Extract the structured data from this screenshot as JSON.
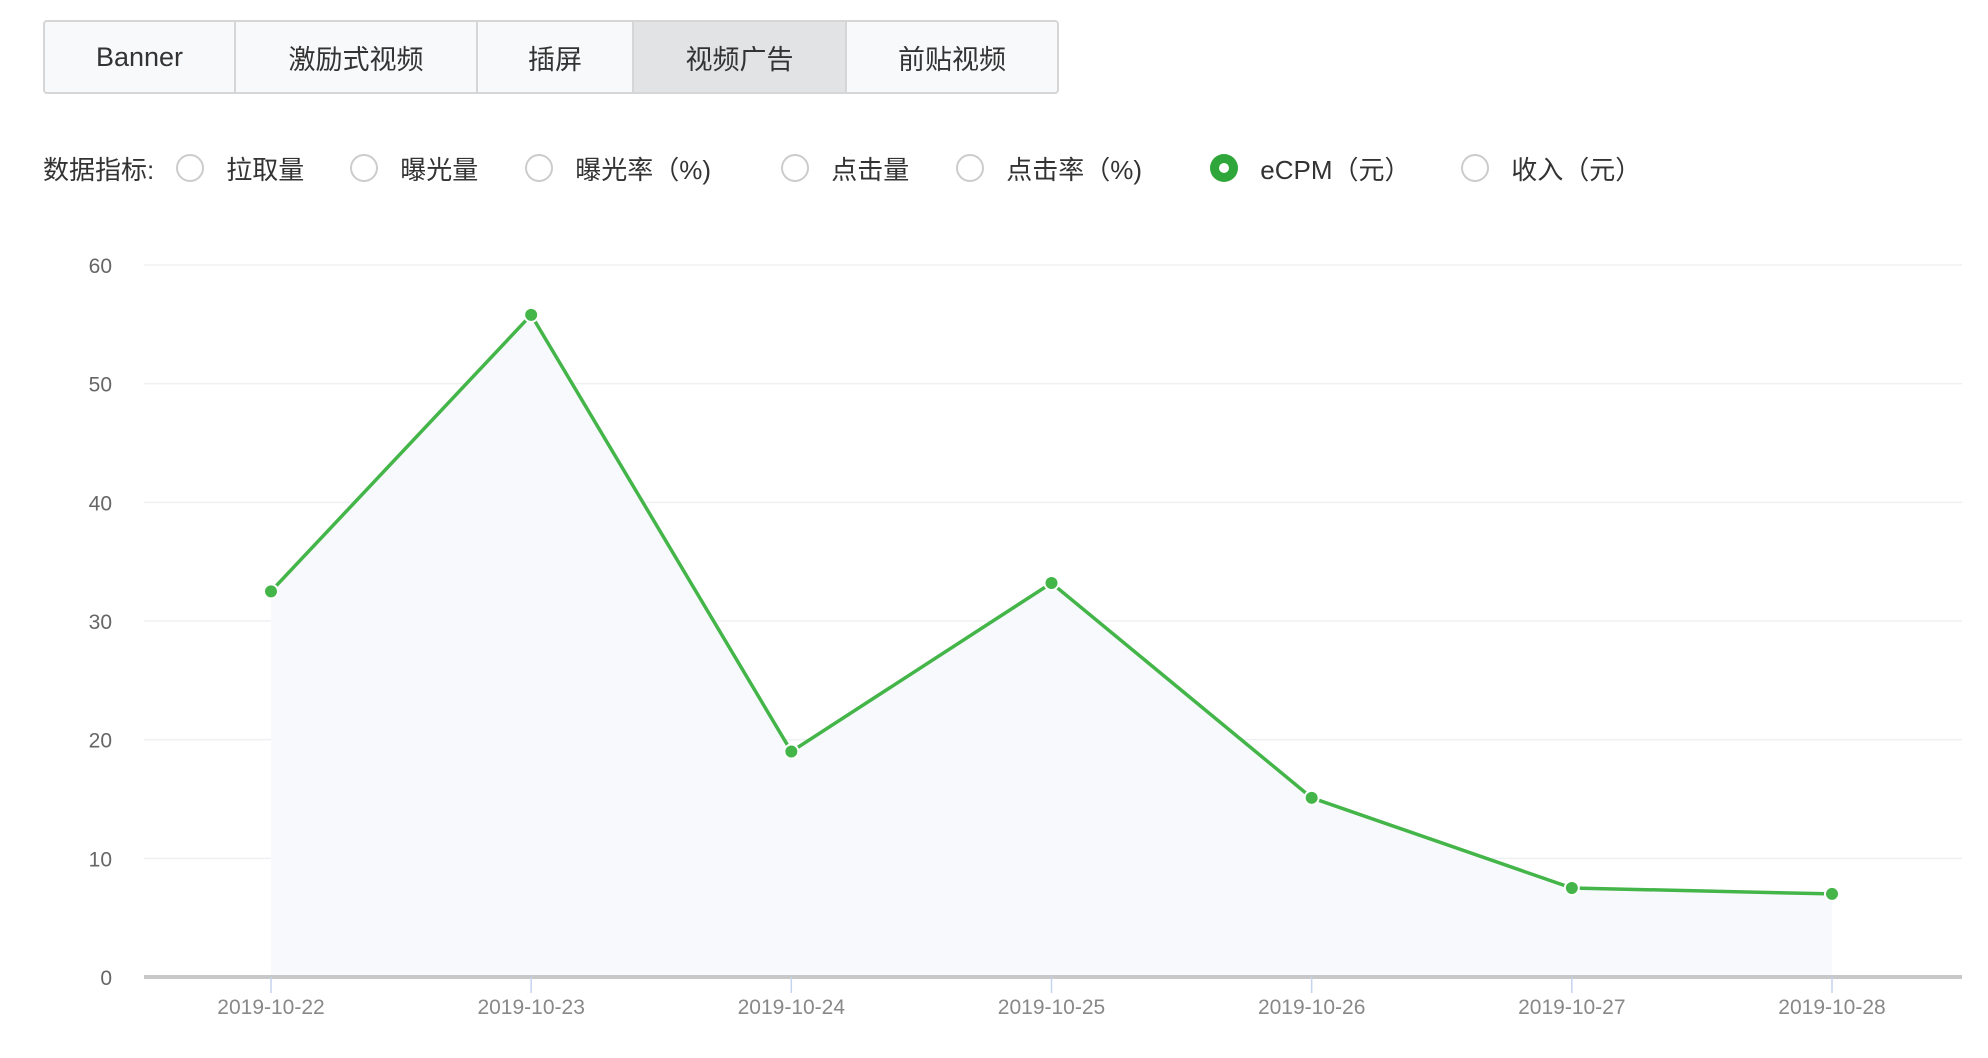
{
  "tabs": [
    {
      "label": "Banner",
      "active": false
    },
    {
      "label": "激励式视频",
      "active": false
    },
    {
      "label": "插屏",
      "active": false
    },
    {
      "label": "视频广告",
      "active": true
    },
    {
      "label": "前贴视频",
      "active": false
    }
  ],
  "metrics": {
    "label": "数据指标:",
    "options": [
      {
        "label": "拉取量",
        "selected": false
      },
      {
        "label": "曝光量",
        "selected": false
      },
      {
        "label": "曝光率（%)",
        "selected": false
      },
      {
        "label": "点击量",
        "selected": false
      },
      {
        "label": "点击率（%)",
        "selected": false
      },
      {
        "label": "eCPM（元）",
        "selected": true
      },
      {
        "label": "收入（元）",
        "selected": false
      }
    ]
  },
  "colors": {
    "line": "#44b549",
    "area": "#f7f9fc",
    "grid": "#eef0f3",
    "axis": "#c8c8c8"
  },
  "chart_data": {
    "type": "line",
    "title": "",
    "xlabel": "",
    "ylabel": "",
    "categories": [
      "2019-10-22",
      "2019-10-23",
      "2019-10-24",
      "2019-10-25",
      "2019-10-26",
      "2019-10-27",
      "2019-10-28"
    ],
    "series": [
      {
        "name": "eCPM（元）",
        "values": [
          32.5,
          55.8,
          19.0,
          33.2,
          15.1,
          7.5,
          7.0
        ]
      }
    ],
    "ylim": [
      0,
      60
    ],
    "yticks": [
      "0",
      "10",
      "20",
      "30",
      "40",
      "50",
      "60"
    ],
    "grid": true,
    "area_fill": true
  }
}
